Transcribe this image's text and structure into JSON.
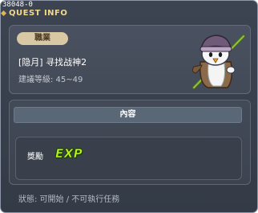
{
  "window": {
    "quest_id": "38048-0",
    "title": "QUEST INFO"
  },
  "quest": {
    "job_label": "職業",
    "name": "[隐月] 寻找战神2",
    "level_text": "建議等級: 45~49",
    "npc_icon": "penguin-npc-icon"
  },
  "content": {
    "header": "內容",
    "reward_label": "獎勵",
    "reward_icon": "exp-icon",
    "reward_text": "EXP"
  },
  "status": {
    "text": "狀態: 可開始 / 不可執行任務"
  },
  "colors": {
    "title": "#f2d98a",
    "badge": "#d9c8a4",
    "exp": "#b6f01e",
    "panel_bg": "#3c4452"
  }
}
